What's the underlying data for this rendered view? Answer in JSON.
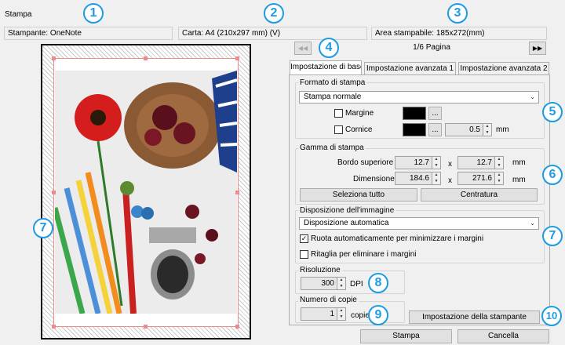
{
  "window": {
    "title": "Stampa"
  },
  "status": {
    "printer": "Stampante: OneNote",
    "paper": "Carta: A4 (210x297 mm) (V)",
    "printable_area": "Area stampabile: 185x272(mm)"
  },
  "pager": {
    "prev": "◀◀",
    "label": "1/6 Pagina",
    "next": "▶▶"
  },
  "tabs": [
    {
      "label": "Impostazione di base",
      "active": true
    },
    {
      "label": "Impostazione avanzata 1",
      "active": false
    },
    {
      "label": "Impostazione avanzata 2",
      "active": false
    }
  ],
  "formato": {
    "label": "Formato di stampa",
    "selected": "Stampa normale",
    "margine_label": "Margine",
    "margine_checked": false,
    "cornice_label": "Cornice",
    "cornice_checked": false,
    "more_btn": "...",
    "cornice_value": "0.5",
    "cornice_unit": "mm",
    "swatch_color": "#000000"
  },
  "gamma": {
    "label": "Gamma di stampa",
    "bordo_label": "Bordo superiore",
    "bordo_x": "12.7",
    "bordo_y": "12.7",
    "dim_label": "Dimensione",
    "dim_w": "184.6",
    "dim_h": "271.6",
    "times": "x",
    "unit": "mm",
    "select_all": "Seleziona tutto",
    "center": "Centratura"
  },
  "disposizione": {
    "label": "Disposizione dell'immagine",
    "selected": "Disposizione automatica",
    "rotate_label": "Ruota automaticamente per minimizzare i margini",
    "rotate_checked": true,
    "crop_label": "Ritaglia per eliminare i margini",
    "crop_checked": false
  },
  "risoluzione": {
    "label": "Risoluzione",
    "value": "300",
    "unit": "DPI"
  },
  "copie": {
    "label": "Numero di copie",
    "value": "1",
    "unit": "copie"
  },
  "buttons": {
    "printer_setup": "Impostazione della stampante",
    "print": "Stampa",
    "cancel": "Cancella"
  },
  "badges": [
    "1",
    "2",
    "3",
    "4",
    "5",
    "6",
    "7",
    "7",
    "8",
    "9",
    "10"
  ],
  "colors": {
    "accent": "#1c9be3",
    "margin_guides": "#f08a8a"
  }
}
